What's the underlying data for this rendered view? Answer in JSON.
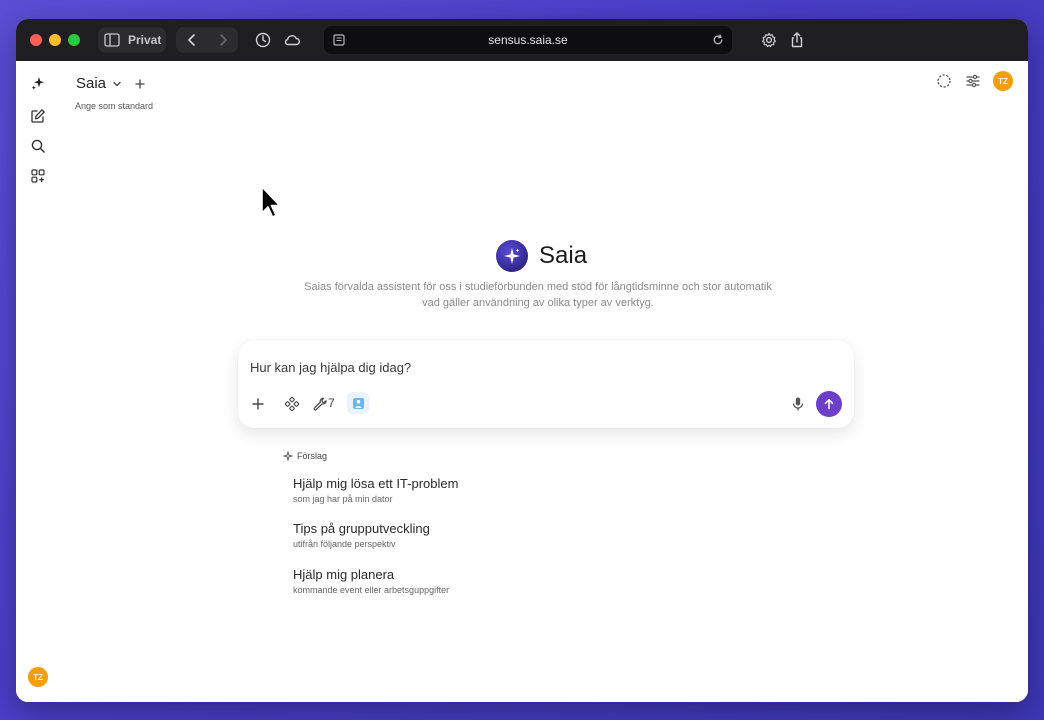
{
  "browser": {
    "private_label": "Privat",
    "url": "sensus.saia.se"
  },
  "header": {
    "model_name": "Saia",
    "set_default_label": "Ange som standard",
    "avatar_initials": "TZ"
  },
  "hero": {
    "title": "Saia",
    "description": "Saias förvalda assistent för oss i studieförbunden med stöd för långtidsminne och stor automatik vad gäller användning av olika typer av verktyg."
  },
  "chat": {
    "placeholder": "Hur kan jag hjälpa dig idag?",
    "tool_count": "7"
  },
  "suggestions": {
    "heading": "Förslag",
    "items": [
      {
        "title": "Hjälp mig lösa ett IT-problem",
        "subtitle": "som jag har på min dator"
      },
      {
        "title": "Tips på grupputveckling",
        "subtitle": "utifrån följande perspektiv"
      },
      {
        "title": "Hjälp mig planera",
        "subtitle": "kommande event eller arbetsguppgifter"
      }
    ]
  },
  "sidebar": {
    "avatar_initials": "TZ"
  },
  "colors": {
    "accent": "#6d3fc8",
    "avatar": "#f59e0b",
    "titlebar": "#1f1f21"
  }
}
